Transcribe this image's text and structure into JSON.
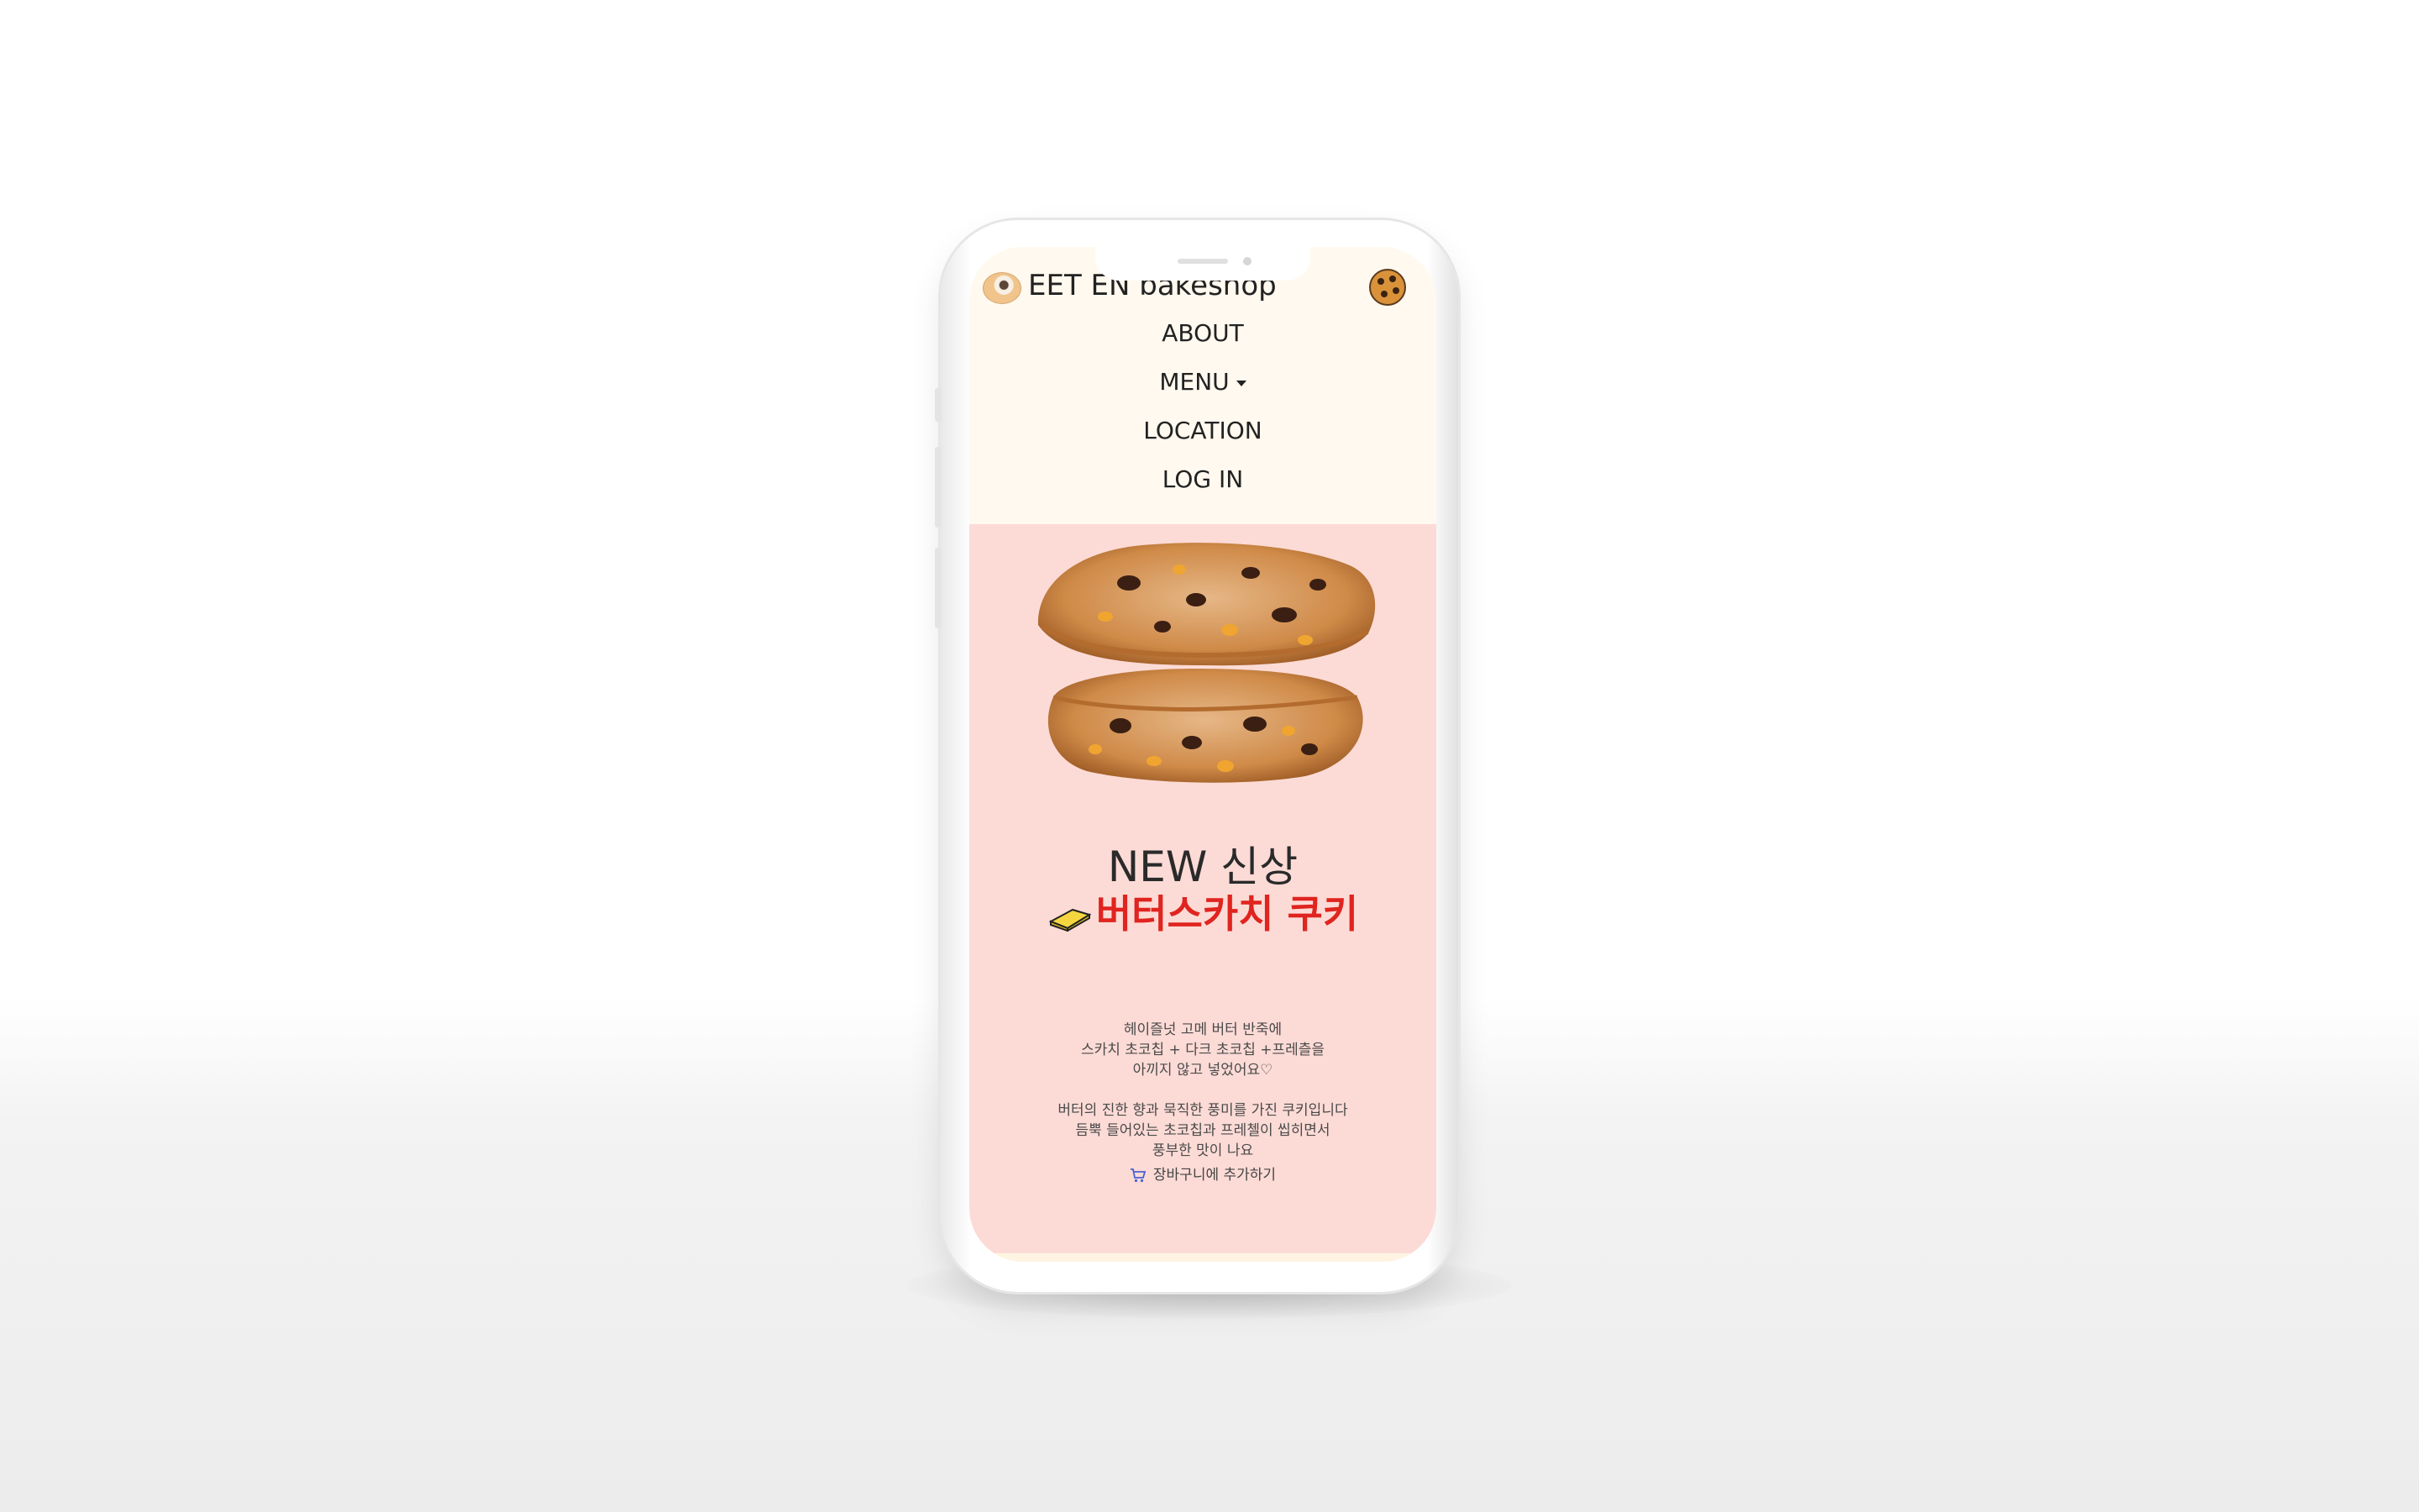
{
  "header": {
    "brand": "EET EN bakeshop"
  },
  "nav": {
    "items": [
      {
        "label": "ABOUT"
      },
      {
        "label": "MENU"
      },
      {
        "label": "LOCATION"
      },
      {
        "label": "LOG IN"
      }
    ]
  },
  "hero": {
    "headline": "NEW 신상",
    "product_name": "버터스카치 쿠키",
    "description_1": [
      "헤이즐넛 고메 버터 반죽에",
      "스카치 초코칩 + 다크 초코칩 +프레츨을",
      "아끼지 않고 넣었어요♡"
    ],
    "description_2": [
      "버터의 진한 향과 묵직한 풍미를 가진 쿠키입니다",
      "듬뿍 들어있는 초코칩과 프레첼이 씹히면서",
      "풍부한 맛이 나요"
    ],
    "cart_label": "장바구니에 추가하기"
  },
  "colors": {
    "page_bg": "#ffffff",
    "nav_bg": "#fff9ef",
    "hero_bg": "#fcdbd6",
    "accent_red": "#e0241f",
    "cart_icon": "#4a5fd6"
  },
  "icons": {
    "brand": "donut-icon",
    "cart_menu": "cookie-icon",
    "butter": "butter-icon",
    "cart": "cart-icon"
  }
}
